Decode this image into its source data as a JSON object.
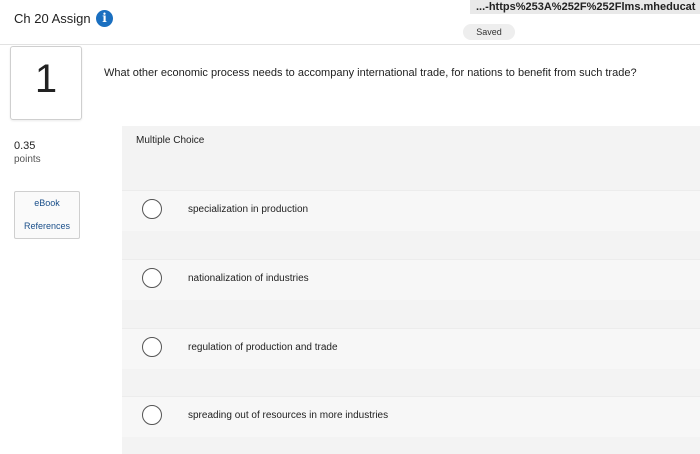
{
  "header": {
    "url_fragment": "...-https%253A%252F%252Flms.mheducat",
    "assignment_title": "Ch 20 Assign",
    "info_icon": "info-icon",
    "saved_status": "Saved"
  },
  "question": {
    "number": "1",
    "points_value": "0.35",
    "points_label": "points",
    "text": "What other economic process needs to accompany international trade, for nations to benefit from such trade?",
    "type_label": "Multiple Choice"
  },
  "side_links": {
    "ebook": "eBook",
    "references": "References"
  },
  "options": [
    {
      "label": "specialization in production"
    },
    {
      "label": "nationalization of industries"
    },
    {
      "label": "regulation of production and trade"
    },
    {
      "label": "spreading out of resources in more industries"
    }
  ],
  "colors": {
    "accent": "#1a6fc0",
    "panel_bg": "#f3f3f3"
  }
}
